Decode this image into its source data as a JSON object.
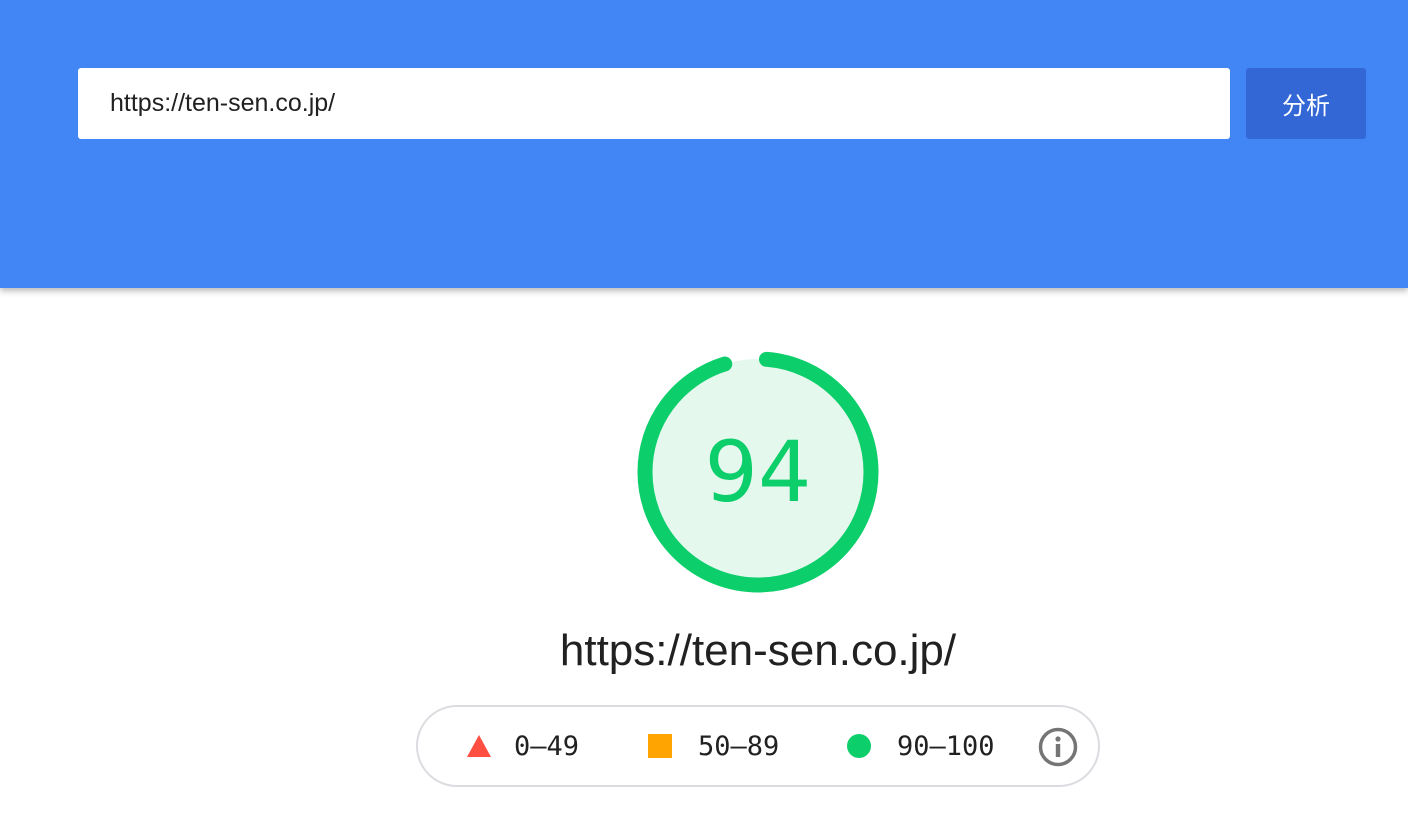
{
  "search": {
    "url_value": "https://ten-sen.co.jp/",
    "analyze_label": "分析"
  },
  "report": {
    "score": "94",
    "score_fraction": 0.94,
    "url": "https://ten-sen.co.jp/"
  },
  "legend": {
    "items": [
      {
        "label": "0–49",
        "icon": "triangle-icon",
        "color": "#ff4e42"
      },
      {
        "label": "50–89",
        "icon": "square-icon",
        "color": "#ffa400"
      },
      {
        "label": "90–100",
        "icon": "circle-icon",
        "color": "#0cce6b"
      }
    ],
    "info_icon": "info-icon"
  },
  "colors": {
    "header": "#4285f4",
    "button": "#3367d6",
    "pass": "#0cce6b",
    "pass_bg": "#e5f8ee",
    "average": "#ffa400",
    "fail": "#ff4e42"
  }
}
